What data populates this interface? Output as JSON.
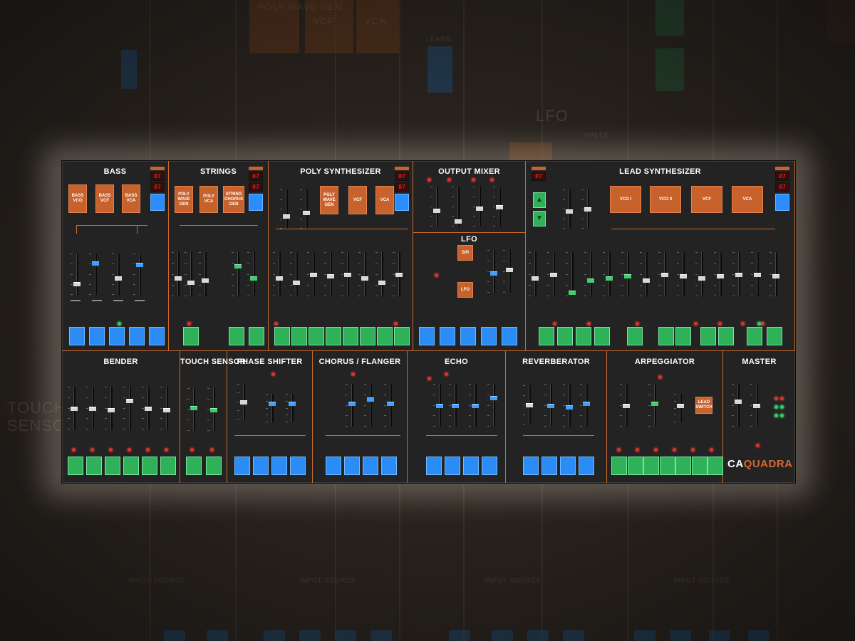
{
  "brand": {
    "prefix": "CA",
    "name": "QUADRA"
  },
  "colors": {
    "accent": "#c8622c",
    "panel": "#232323",
    "pad_blue": "#2b8cf6",
    "pad_green": "#2fb15a",
    "led_red": "#e0302a"
  },
  "background": {
    "labels": [
      "LFO",
      "TOUCH",
      "SENSOR",
      "POLY WAVE GEN",
      "VCF",
      "VCA",
      "LEARN",
      "SPEED",
      "INPUT SOURCE",
      "INPUT SOURCE",
      "INPUT SOURCE",
      "INPUT SOURCE"
    ]
  },
  "top_sections": {
    "bass": {
      "title": "BASS",
      "boxes": [
        "BASS VCO",
        "BASS VCF",
        "BASS VCA"
      ]
    },
    "strings": {
      "title": "STRINGS",
      "boxes": [
        "POLY WAVE GEN",
        "POLY VCA",
        "STRING CHORUS GEN"
      ]
    },
    "poly": {
      "title": "POLY SYNTHESIZER",
      "boxes": [
        "POLY WAVE GEN",
        "VCF",
        "VCA"
      ]
    },
    "output_mixer": {
      "title": "OUTPUT MIXER"
    },
    "lfo": {
      "title": "LFO",
      "boxes": [
        "S/H",
        "LFO"
      ]
    },
    "lead": {
      "title": "LEAD SYNTHESIZER",
      "boxes": [
        "VCO I",
        "VCO II",
        "VCF",
        "VCA"
      ]
    }
  },
  "range_displays": [
    "07",
    "07",
    "07",
    "07",
    "07",
    "07"
  ],
  "bottom_sections": {
    "bender": {
      "title": "BENDER"
    },
    "touch": {
      "title": "TOUCH SENSOR"
    },
    "phase": {
      "title": "PHASE SHIFTER"
    },
    "chorus": {
      "title": "CHORUS / FLANGER"
    },
    "echo": {
      "title": "ECHO"
    },
    "reverb": {
      "title": "REVERBERATOR"
    },
    "arp": {
      "title": "ARPEGGIATOR",
      "box": "LEAD SWITCH"
    },
    "master": {
      "title": "MASTER"
    }
  }
}
